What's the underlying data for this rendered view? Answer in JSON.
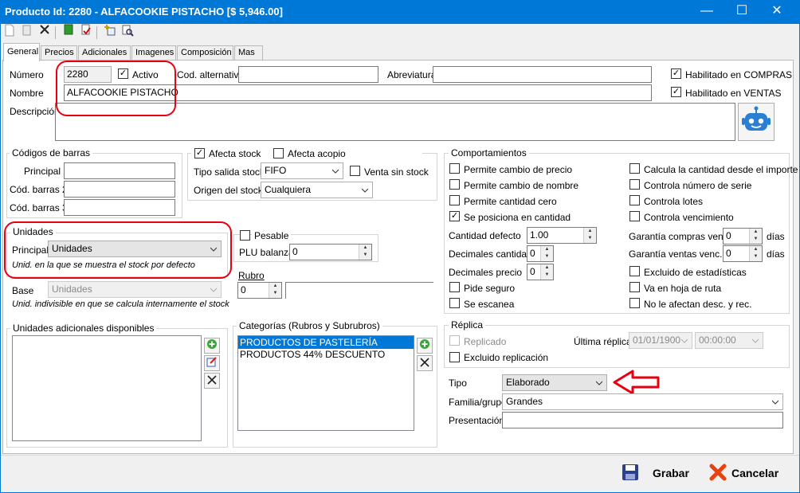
{
  "window": {
    "title": "Producto Id: 2280 - ALFACOOKIE PISTACHO  [$ 5,946.00]",
    "minimize_glyph": "—",
    "maximize_glyph": "☐",
    "close_glyph": "✕"
  },
  "tabs": [
    {
      "label": "General"
    },
    {
      "label": "Precios"
    },
    {
      "label": "Adicionales"
    },
    {
      "label": "Imagenes"
    },
    {
      "label": "Composición"
    },
    {
      "label": "Mas"
    }
  ],
  "general": {
    "numero_label": "Número",
    "numero_value": "2280",
    "activo_label": "Activo",
    "cod_alt_label": "Cod. alternativo",
    "cod_alt_value": "",
    "abreviatura_label": "Abreviatura",
    "abreviatura_value": "",
    "habilitado_compras_label": "Habilitado en COMPRAS",
    "habilitado_ventas_label": "Habilitado en VENTAS",
    "nombre_label": "Nombre",
    "nombre_value": "ALFACOOKIE PISTACHO",
    "descripcion_label": "Descripción",
    "descripcion_value": ""
  },
  "codigos": {
    "title": "Códigos de barras",
    "principal_label": "Principal",
    "barras2_label": "Cód. barras 2",
    "barras3_label": "Cód. barras 3"
  },
  "stock": {
    "afecta_stock_label": "Afecta stock",
    "afecta_acopio_label": "Afecta acopio",
    "tipo_salida_label": "Tipo salida stock",
    "tipo_salida_value": "FIFO",
    "venta_sin_stock_label": "Venta sin stock",
    "origen_label": "Origen del stock",
    "origen_value": "Cualquiera"
  },
  "unidades": {
    "title": "Unidades",
    "principal_label": "Principal",
    "principal_value": "Unidades",
    "principal_hint": "Unid. en la que se muestra el stock por defecto",
    "base_label": "Base",
    "base_value": "Unidades",
    "base_hint": "Unid. indivisible en que se calcula internamente el stock",
    "adicionales_title": "Unidades adicionales disponibles"
  },
  "pesable": {
    "label": "Pesable",
    "plu_label": "PLU balanza",
    "plu_value": "0"
  },
  "rubro": {
    "label": "Rubro",
    "value": "0"
  },
  "categorias": {
    "title": "Categorías (Rubros y Subrubros)",
    "items": [
      "PRODUCTOS DE PASTELERÍA",
      "PRODUCTOS 44% DESCUENTO"
    ]
  },
  "comportamientos": {
    "title": "Comportamientos",
    "left": [
      {
        "label": "Permite cambio de precio",
        "checked": false
      },
      {
        "label": "Permite cambio de nombre",
        "checked": false
      },
      {
        "label": "Permite cantidad cero",
        "checked": false
      },
      {
        "label": "Se posiciona en cantidad",
        "checked": true
      }
    ],
    "right": [
      {
        "label": "Calcula la cantidad desde el importe",
        "checked": false
      },
      {
        "label": "Controla número de serie",
        "checked": false
      },
      {
        "label": "Controla lotes",
        "checked": false
      },
      {
        "label": "Controla vencimiento",
        "checked": false
      }
    ],
    "cantidad_defecto_label": "Cantidad defecto",
    "cantidad_defecto_value": "1.00",
    "dec_cantidad_label": "Decimales cantidad",
    "dec_cantidad_value": "0",
    "dec_precio_label": "Decimales precio",
    "dec_precio_value": "0",
    "pide_seguro_label": "Pide seguro",
    "se_escanea_label": "Se escanea",
    "garantia_compras_label": "Garantía compras venc.",
    "garantia_compras_value": "0",
    "garantia_ventas_label": "Garantía ventas venc.",
    "garantia_ventas_value": "0",
    "dias_label": "días",
    "excluido_estadisticas_label": "Excluido de estadísticas",
    "hoja_ruta_label": "Va en hoja de ruta",
    "no_afectan_label": "No le afectan desc. y rec."
  },
  "replica": {
    "title": "Réplica",
    "replicado_label": "Replicado",
    "ultima_label": "Última réplica:",
    "fecha_value": "01/01/1900",
    "hora_value": "00:00:00",
    "excluido_label": "Excluido replicación"
  },
  "tipo": {
    "label": "Tipo",
    "value": "Elaborado",
    "familia_label": "Familia/grupo",
    "familia_value": "Grandes",
    "presentacion_label": "Presentación",
    "presentacion_value": ""
  },
  "footer": {
    "grabar": "Grabar",
    "cancelar": "Cancelar"
  },
  "colors": {
    "titlebar": "#0078d7",
    "annotation_red": "#e8000f",
    "selection": "#0078d7"
  }
}
